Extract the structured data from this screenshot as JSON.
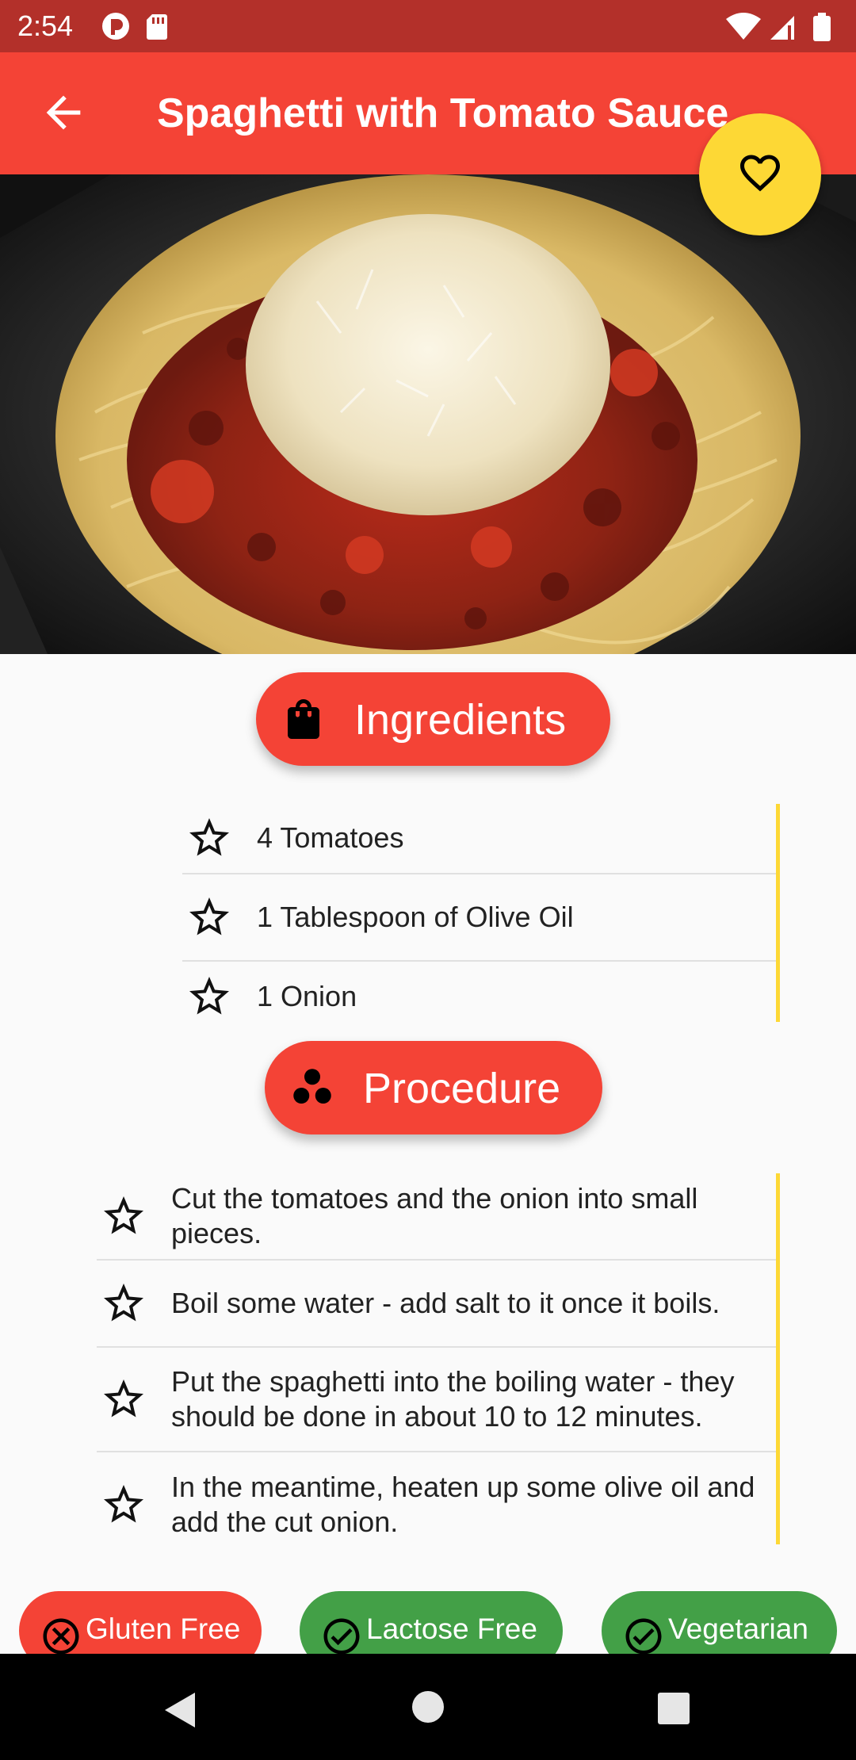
{
  "status_bar": {
    "time": "2:54"
  },
  "app_bar": {
    "title": "Spaghetti with Tomato Sauce"
  },
  "hero_image": {
    "alt": "spaghetti-photo"
  },
  "ingredients": {
    "header_label": "Ingredients",
    "items": [
      "4 Tomatoes",
      "1 Tablespoon of Olive Oil",
      "1 Onion"
    ]
  },
  "procedure": {
    "header_label": "Procedure",
    "steps": [
      "Cut the tomatoes and the onion into small pieces.",
      "Boil some water - add salt to it once it boils.",
      "Put the spaghetti into the boiling water - they should be done in about 10 to 12 minutes.",
      "In the meantime, heaten up some olive oil and add the cut onion."
    ]
  },
  "tags": {
    "gluten_free": "Gluten Free",
    "lactose_free": "Lactose Free",
    "vegetarian": "Vegetarian"
  },
  "colors": {
    "primary": "#f44336",
    "status_bar": "#b3302a",
    "accent": "#fdd835",
    "tag_negative": "#f44336",
    "tag_positive": "#43a047"
  },
  "icons": {
    "back": "arrow-left-icon",
    "favorite": "heart-outline-icon",
    "ingredients": "shopping-bag-icon",
    "procedure": "grain-icon",
    "list_item": "star-outline-icon",
    "tag_no": "close-circle-icon",
    "tag_yes": "check-circle-icon"
  }
}
